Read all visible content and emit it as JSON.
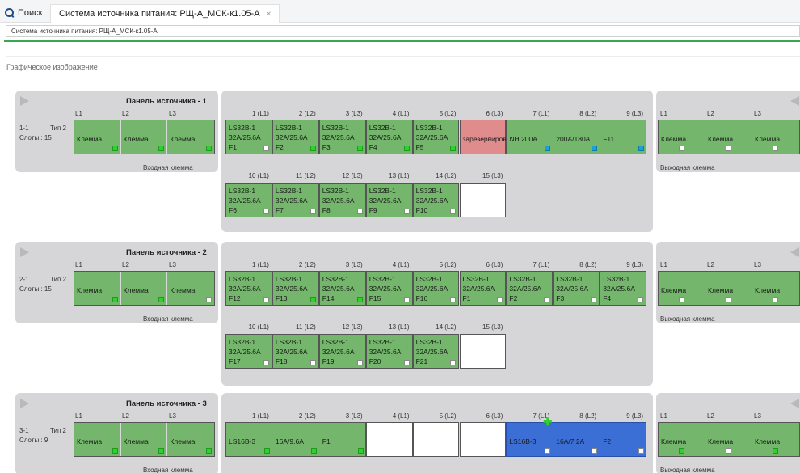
{
  "header": {
    "search_label": "Поиск",
    "doc_tab_label": "Система источника питания: РЩ-А_МСК-к1.05-А",
    "tab_close": "×",
    "breadcrumb": "Система источника питания: РЩ-А_МСК-к1.05-А"
  },
  "section_title": "Графическое изображение",
  "terminal_text": "Клемма",
  "phases": [
    "L1",
    "L2",
    "L3"
  ],
  "input_terminal_label": "Входная клемма",
  "output_terminal_label": "Выходная клемма",
  "slot_headers_row1": [
    "1 (L1)",
    "2 (L2)",
    "3 (L3)",
    "4 (L1)",
    "5 (L2)",
    "6 (L3)",
    "7 (L1)",
    "8 (L2)",
    "9 (L3)"
  ],
  "slot_headers_row2": [
    "10 (L1)",
    "11 (L2)",
    "12 (L3)",
    "13 (L1)",
    "14 (L2)",
    "15 (L3)"
  ],
  "panels": [
    {
      "title": "Панель источника - 1",
      "id": "1-1",
      "type": "Тип 2",
      "slots": "Слоты : 15",
      "input_inds": [
        "green",
        "green",
        "green"
      ],
      "output_inds": [
        "white",
        "white",
        "white"
      ],
      "row1": [
        {
          "kind": "std",
          "l1": "LS32B-1",
          "l2": "32A/25.6A",
          "l3": "F1",
          "ind": "white"
        },
        {
          "kind": "std",
          "l1": "LS32B-1",
          "l2": "32A/25.6A",
          "l3": "F2",
          "ind": "green"
        },
        {
          "kind": "std",
          "l1": "LS32B-1",
          "l2": "32A/25.6A",
          "l3": "F3",
          "ind": "green"
        },
        {
          "kind": "std",
          "l1": "LS32B-1",
          "l2": "32A/25.6A",
          "l3": "F4",
          "ind": "green"
        },
        {
          "kind": "std",
          "l1": "LS32B-1",
          "l2": "32A/25.6A",
          "l3": "F5",
          "ind": "green"
        },
        {
          "kind": "reserved",
          "mid": "зарезервированный"
        },
        {
          "kind": "wide3",
          "parts": [
            "NH 200A",
            "200A/180A",
            "F11"
          ],
          "inds": [
            "blue",
            "blue",
            "blue"
          ]
        }
      ],
      "row2": [
        {
          "kind": "std",
          "l1": "LS32B-1",
          "l2": "32A/25.6A",
          "l3": "F6",
          "ind": "white"
        },
        {
          "kind": "std",
          "l1": "LS32B-1",
          "l2": "32A/25.6A",
          "l3": "F7",
          "ind": "white"
        },
        {
          "kind": "std",
          "l1": "LS32B-1",
          "l2": "32A/25.6A",
          "l3": "F8",
          "ind": "white"
        },
        {
          "kind": "std",
          "l1": "LS32B-1",
          "l2": "32A/25.6A",
          "l3": "F9",
          "ind": "white"
        },
        {
          "kind": "std",
          "l1": "LS32B-1",
          "l2": "32A/25.6A",
          "l3": "F10",
          "ind": "white"
        },
        {
          "kind": "empty"
        }
      ]
    },
    {
      "title": "Панель источника - 2",
      "id": "2-1",
      "type": "Тип 2",
      "slots": "Слоты : 15",
      "input_inds": [
        "green",
        "green",
        "white"
      ],
      "output_inds": [
        "white",
        "white",
        "white"
      ],
      "row1": [
        {
          "kind": "std",
          "l1": "LS32B-1",
          "l2": "32A/25.6A",
          "l3": "F12",
          "ind": "white"
        },
        {
          "kind": "std",
          "l1": "LS32B-1",
          "l2": "32A/25.6A",
          "l3": "F13",
          "ind": "green"
        },
        {
          "kind": "std",
          "l1": "LS32B-1",
          "l2": "32A/25.6A",
          "l3": "F14",
          "ind": "green"
        },
        {
          "kind": "std",
          "l1": "LS32B-1",
          "l2": "32A/25.6A",
          "l3": "F15",
          "ind": "white"
        },
        {
          "kind": "std",
          "l1": "LS32B-1",
          "l2": "32A/25.6A",
          "l3": "F16",
          "ind": "white"
        },
        {
          "kind": "std",
          "l1": "LS32B-1",
          "l2": "32A/25.6A",
          "l3": "F1",
          "ind": "white"
        },
        {
          "kind": "std",
          "l1": "LS32B-1",
          "l2": "32A/25.6A",
          "l3": "F2",
          "ind": "white"
        },
        {
          "kind": "std",
          "l1": "LS32B-1",
          "l2": "32A/25.6A",
          "l3": "F3",
          "ind": "white"
        },
        {
          "kind": "std",
          "l1": "LS32B-1",
          "l2": "32A/25.6A",
          "l3": "F4",
          "ind": "white"
        }
      ],
      "row2": [
        {
          "kind": "std",
          "l1": "LS32B-1",
          "l2": "32A/25.6A",
          "l3": "F17",
          "ind": "white"
        },
        {
          "kind": "std",
          "l1": "LS32B-1",
          "l2": "32A/25.6A",
          "l3": "F18",
          "ind": "white"
        },
        {
          "kind": "std",
          "l1": "LS32B-1",
          "l2": "32A/25.6A",
          "l3": "F19",
          "ind": "white"
        },
        {
          "kind": "std",
          "l1": "LS32B-1",
          "l2": "32A/25.6A",
          "l3": "F20",
          "ind": "white"
        },
        {
          "kind": "std",
          "l1": "LS32B-1",
          "l2": "32A/25.6A",
          "l3": "F21",
          "ind": "white"
        },
        {
          "kind": "empty"
        }
      ]
    },
    {
      "title": "Панель источника - 3",
      "id": "3-1",
      "type": "Тип 2",
      "slots": "Слоты : 9",
      "input_inds": [
        "green",
        "green",
        "green"
      ],
      "output_inds": [
        "green",
        "white",
        "green"
      ],
      "row1": [
        {
          "kind": "wide3",
          "parts": [
            "LS16B-3",
            "16A/9.6A",
            "F1"
          ],
          "inds": [
            "green",
            "green",
            "green"
          ]
        },
        {
          "kind": "empty"
        },
        {
          "kind": "empty"
        },
        {
          "kind": "empty"
        },
        {
          "kind": "wide3sel",
          "parts": [
            "LS16B-3",
            "16A/7.2A",
            "F2"
          ],
          "inds": [
            "white",
            "white",
            "white"
          ]
        }
      ],
      "row2": []
    }
  ]
}
